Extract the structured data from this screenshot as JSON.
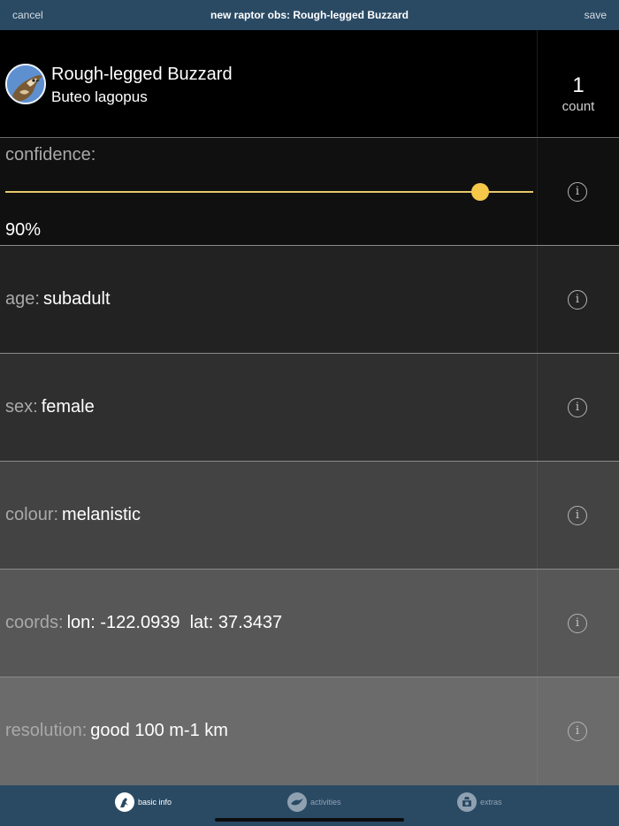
{
  "navbar": {
    "cancel_label": "cancel",
    "title": "new raptor obs: Rough-legged Buzzard",
    "save_label": "save"
  },
  "species": {
    "common_name": "Rough-legged Buzzard",
    "latin_name": "Buteo lagopus",
    "count_value": "1",
    "count_label": "count"
  },
  "confidence": {
    "label": "confidence:",
    "value_text": "90%",
    "value": 0.9
  },
  "fields": [
    {
      "label": "age:",
      "value": "subadult",
      "bg": "#222222"
    },
    {
      "label": "sex:",
      "value": "female",
      "bg": "#2f2f2f"
    },
    {
      "label": "colour:",
      "value": "melanistic",
      "bg": "#434343"
    },
    {
      "label": "coords:",
      "value": "lon: -122.0939  lat: 37.3437",
      "bg": "#575757"
    },
    {
      "label": "resolution:",
      "value": "good 100 m-1 km",
      "bg": "#6b6b6b"
    }
  ],
  "info_icon": "i",
  "tabs": [
    {
      "label": "basic info",
      "icon": "bird-icon",
      "active": true
    },
    {
      "label": "activities",
      "icon": "activities-icon",
      "active": false
    },
    {
      "label": "extras",
      "icon": "camera-icon",
      "active": false
    }
  ],
  "colors": {
    "bar_bg": "#2a4a64",
    "slider_track": "#e7c86a",
    "slider_thumb": "#f5c84a",
    "tab_active": "#ffffff",
    "tab_inactive": "#8fa1b1"
  }
}
